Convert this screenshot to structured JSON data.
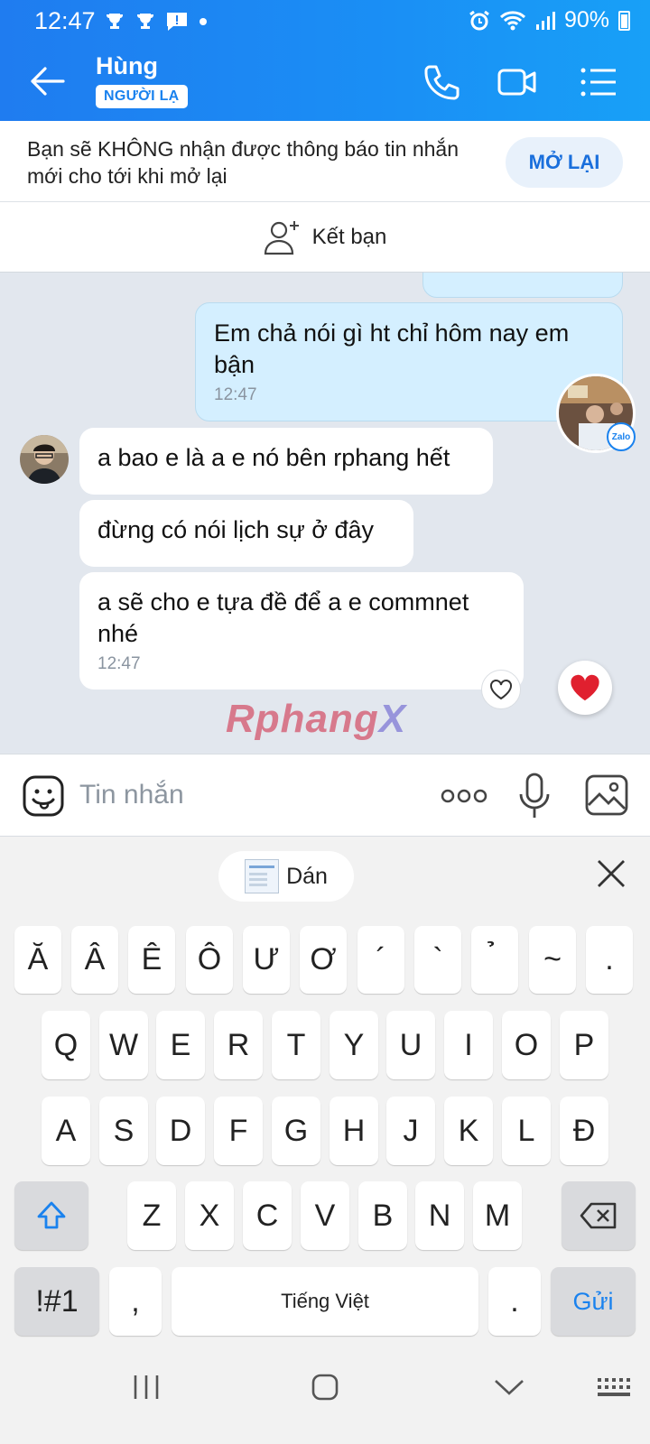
{
  "status_bar": {
    "time": "12:47",
    "battery": "90%"
  },
  "header": {
    "name": "Hùng",
    "badge": "NGƯỜI LẠ"
  },
  "notice": {
    "text": "Bạn sẽ KHÔNG nhận được thông báo tin nhắn mới cho tới khi mở lại",
    "button": "MỞ LẠI"
  },
  "add_friend": {
    "label": "Kết bạn"
  },
  "messages": [
    {
      "from": "me",
      "text": "Em chả nói gì ht chỉ hôm nay em bận",
      "time": "12:47"
    },
    {
      "from": "them",
      "text": "a bao e là a e nó bên rphang hết"
    },
    {
      "from": "them",
      "text": "đừng có nói lịch sự ở đây"
    },
    {
      "from": "them",
      "text": "a sẽ cho e tựa đề để a e commnet nhé",
      "time": "12:47"
    }
  ],
  "avatar_badge": "Zalo",
  "watermark": {
    "part1": "Rphang",
    "part2": "X"
  },
  "composer": {
    "placeholder": "Tin nhắn"
  },
  "clipboard": {
    "paste_label": "Dán"
  },
  "keyboard": {
    "row0": [
      "Ă",
      "Â",
      "Ê",
      "Ô",
      "Ư",
      "Ơ",
      "´",
      "`",
      "̉",
      "~",
      "."
    ],
    "row1": [
      "Q",
      "W",
      "E",
      "R",
      "T",
      "Y",
      "U",
      "I",
      "O",
      "P"
    ],
    "row2": [
      "A",
      "S",
      "D",
      "F",
      "G",
      "H",
      "J",
      "K",
      "L",
      "Đ"
    ],
    "row3": [
      "Z",
      "X",
      "C",
      "V",
      "B",
      "N",
      "M"
    ],
    "symbols": "!#1",
    "comma": ",",
    "space": "Tiếng Việt",
    "period": ".",
    "send": "Gửi"
  },
  "colors": {
    "header": "#1f7cf0",
    "accent": "#1a82ee",
    "my_bubble": "#d4efff",
    "heart": "#e0202f"
  }
}
